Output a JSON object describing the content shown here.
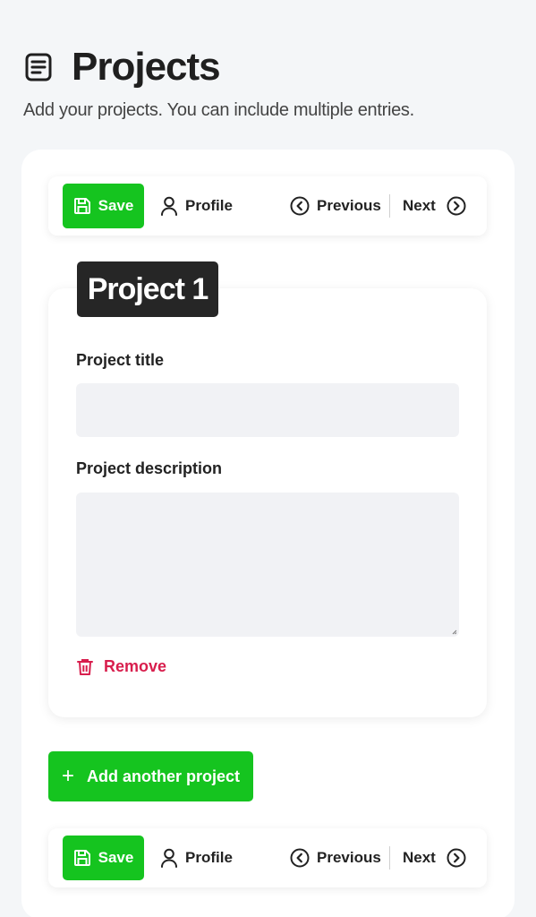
{
  "header": {
    "title": "Projects",
    "subtitle": "Add your projects. You can include multiple entries.",
    "icon": "document-icon"
  },
  "toolbar": {
    "save_label": "Save",
    "profile_label": "Profile",
    "previous_label": "Previous",
    "next_label": "Next"
  },
  "project": {
    "badge": "Project 1",
    "title_label": "Project title",
    "title_value": "",
    "description_label": "Project description",
    "description_value": "",
    "remove_label": "Remove"
  },
  "add_label": "Add another project",
  "colors": {
    "accent_green": "#15c41f",
    "danger": "#d81e4d",
    "badge_bg": "#262626",
    "input_bg": "#f1f2f5"
  }
}
